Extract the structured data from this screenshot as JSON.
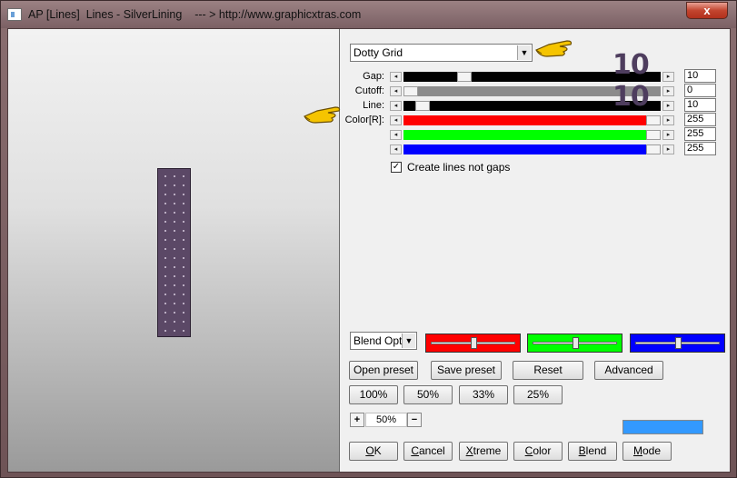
{
  "window": {
    "title": "AP [Lines]  Lines - SilverLining    --- > http://www.graphicxtras.com",
    "close_label": "x"
  },
  "preset_dropdown": {
    "value": "Dotty Grid"
  },
  "params": [
    {
      "label": "Gap:",
      "value": "10",
      "track_color": "#000000",
      "fraction": 0.22
    },
    {
      "label": "Cutoff:",
      "value": "0",
      "track_color": "#8c8c8c",
      "fraction": 0.0
    },
    {
      "label": "Line:",
      "value": "10",
      "track_color": "#000000",
      "fraction": 0.05
    },
    {
      "label": "Color[R]:",
      "value": "255",
      "track_color": "#ff0000",
      "fraction": 1.0
    },
    {
      "label": "",
      "value": "255",
      "track_color": "#00ff00",
      "fraction": 1.0
    },
    {
      "label": "",
      "value": "255",
      "track_color": "#0000ff",
      "fraction": 1.0
    }
  ],
  "overlay_numbers": [
    "10",
    "10"
  ],
  "checkbox": {
    "label": "Create lines not gaps",
    "checked": true,
    "mark": "✓"
  },
  "blend": {
    "dropdown_value": "Blend Optio",
    "sliders": [
      {
        "color": "#ff0000",
        "fraction": 0.5
      },
      {
        "color": "#00ff00",
        "fraction": 0.5
      },
      {
        "color": "#0000ff",
        "fraction": 0.5
      }
    ]
  },
  "buttons_row1": [
    "Open preset",
    "Save preset",
    "Reset",
    "Advanced"
  ],
  "buttons_row2": [
    "100%",
    "50%",
    "33%",
    "25%"
  ],
  "zoom": {
    "plus": "+",
    "value": "50%",
    "minus": "−"
  },
  "swatch_color": "#3399ff",
  "buttons_bottom": [
    "OK",
    "Cancel",
    "Xtreme",
    "Color",
    "Blend",
    "Mode"
  ],
  "colors": {
    "preview_strip": "#5b4866",
    "overlay_number": "#4e3d5e",
    "hand": "#f5c400"
  }
}
